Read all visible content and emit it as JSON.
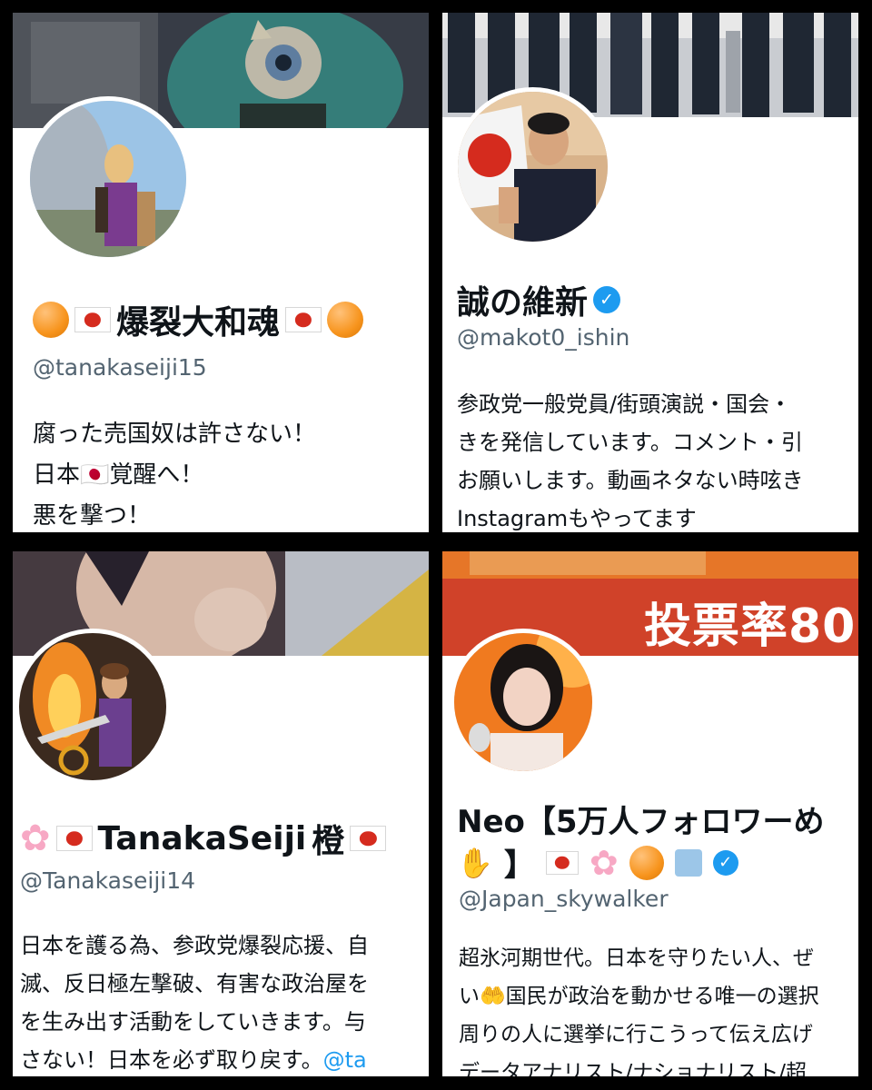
{
  "profiles": [
    {
      "name": "爆裂大和魂",
      "handle": "@tanakaseiji15",
      "bio": "腐った売国奴は許さない！\n日本🇯🇵覚醒へ！\n悪を撃つ！"
    },
    {
      "name": "誠の維新",
      "handle": "@makot0_ishin",
      "verified_mark": "✓",
      "bio": "参政党一般党員/街頭演説・国会・\nきを発信しています。コメント・引\nお願いします。動画ネタない時呟き\nInstagramもやってます"
    },
    {
      "name": "TanakaSeiji",
      "name_suffix": "橙",
      "handle": "@Tanakaseiji14",
      "bio": "日本を護る為、参政党爆裂応援、自\n滅、反日極左撃破、有害な政治屋を\nを生み出す活動をしていきます。与\nさない！日本を必ず取り戻す。",
      "bio_link": "@ta"
    },
    {
      "name": "Neo【5万人フォロワーめ",
      "name_line2_end": "】",
      "handle": "@Japan_skywalker",
      "banner_text": "投票率80",
      "verified_mark": "✓",
      "bio": "超氷河期世代。日本を守りたい人、ぜ\nい🤲国民が政治を動かせる唯一の選択\n周りの人に選挙に行こうって伝え広げ\nデータアナリスト/ナショナリスト/超"
    }
  ],
  "icons": {
    "flag": "japan-flag-icon",
    "orange": "orange-circle-icon",
    "verified": "verified-badge-icon",
    "blossom": "cherry-blossom-icon",
    "handshake": "handshake-icon",
    "ballot": "ballot-box-icon"
  },
  "colors": {
    "handle": "#536471",
    "verified": "#1d9bf0",
    "flag_red": "#d52b1e",
    "text": "#0f1419"
  }
}
